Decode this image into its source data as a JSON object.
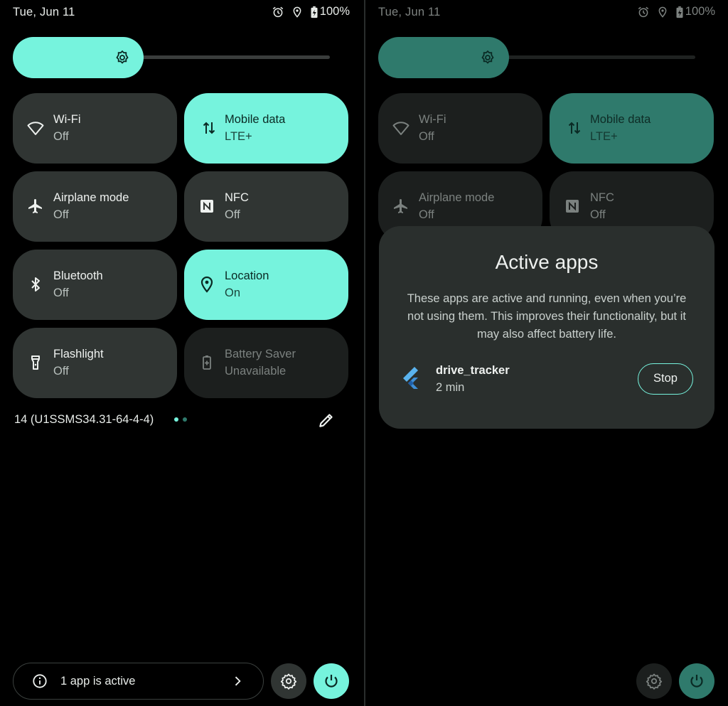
{
  "status_bar": {
    "date": "Tue, Jun 11",
    "battery": "100%"
  },
  "tiles": [
    {
      "title": "Wi-Fi",
      "subtitle": "Off"
    },
    {
      "title": "Mobile data",
      "subtitle": "LTE+"
    },
    {
      "title": "Airplane mode",
      "subtitle": "Off"
    },
    {
      "title": "NFC",
      "subtitle": "Off"
    },
    {
      "title": "Bluetooth",
      "subtitle": "Off"
    },
    {
      "title": "Location",
      "subtitle": "On"
    },
    {
      "title": "Flashlight",
      "subtitle": "Off"
    },
    {
      "title": "Battery Saver",
      "subtitle": "Unavailable"
    }
  ],
  "build_number": "14 (U1SSMS34.31-64-4-4)",
  "footer": {
    "active_apps_label": "1 app is active"
  },
  "dialog": {
    "title": "Active apps",
    "body": "These apps are active and running, even when you’re not using them. This improves their functionality, but it may also affect battery life.",
    "app_name": "drive_tracker",
    "app_time": "2 min",
    "stop_label": "Stop"
  },
  "colors": {
    "accent": "#76f3dd",
    "accent_dim": "#2f7a6c",
    "tile_off": "#303533",
    "tile_dim": "#1c1f1e",
    "dialog_bg": "#2a2f2d"
  },
  "icons": {
    "status": [
      "alarm-icon",
      "location-pin-icon",
      "battery-charging-icon"
    ],
    "brightness": "brightness-icon",
    "tiles": [
      "wifi-icon",
      "mobile-data-icon",
      "airplane-icon",
      "nfc-icon",
      "bluetooth-icon",
      "location-icon",
      "flashlight-icon",
      "battery-saver-icon"
    ],
    "footer": [
      "info-icon",
      "chevron-right-icon",
      "settings-icon",
      "power-icon"
    ],
    "app": "flutter-icon",
    "edit": "edit-pencil-icon"
  }
}
